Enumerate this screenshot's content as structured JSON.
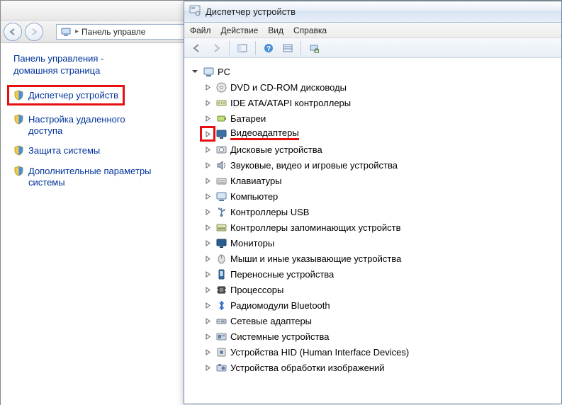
{
  "cp": {
    "breadcrumb_label": "Панель управле",
    "home_line1": "Панель управления -",
    "home_line2": "домашняя страница",
    "links": {
      "device_mgr": "Диспетчер устройств",
      "remote1": "Настройка удаленного",
      "remote2": "доступа",
      "sysprotect": "Защита системы",
      "advanced1": "Дополнительные параметры",
      "advanced2": "системы"
    }
  },
  "dm": {
    "title": "Диспетчер устройств",
    "menu": {
      "file": "Файл",
      "action": "Действие",
      "view": "Вид",
      "help": "Справка"
    },
    "root": "PC",
    "categories": [
      {
        "label": "DVD и CD-ROM дисководы",
        "icon": "disc"
      },
      {
        "label": "IDE ATA/ATAPI контроллеры",
        "icon": "ide"
      },
      {
        "label": "Батареи",
        "icon": "battery"
      },
      {
        "label": "Видеоадаптеры",
        "icon": "display",
        "highlight": true
      },
      {
        "label": "Дисковые устройства",
        "icon": "hdd"
      },
      {
        "label": "Звуковые, видео и игровые устройства",
        "icon": "sound"
      },
      {
        "label": "Клавиатуры",
        "icon": "keyboard"
      },
      {
        "label": "Компьютер",
        "icon": "computer"
      },
      {
        "label": "Контроллеры USB",
        "icon": "usb"
      },
      {
        "label": "Контроллеры запоминающих устройств",
        "icon": "storagectrl"
      },
      {
        "label": "Мониторы",
        "icon": "monitor"
      },
      {
        "label": "Мыши и иные указывающие устройства",
        "icon": "mouse"
      },
      {
        "label": "Переносные устройства",
        "icon": "portable"
      },
      {
        "label": "Процессоры",
        "icon": "cpu"
      },
      {
        "label": "Радиомодули Bluetooth",
        "icon": "bluetooth"
      },
      {
        "label": "Сетевые адаптеры",
        "icon": "network"
      },
      {
        "label": "Системные устройства",
        "icon": "system"
      },
      {
        "label": "Устройства HID (Human Interface Devices)",
        "icon": "hid"
      },
      {
        "label": "Устройства обработки изображений",
        "icon": "imaging"
      }
    ]
  }
}
